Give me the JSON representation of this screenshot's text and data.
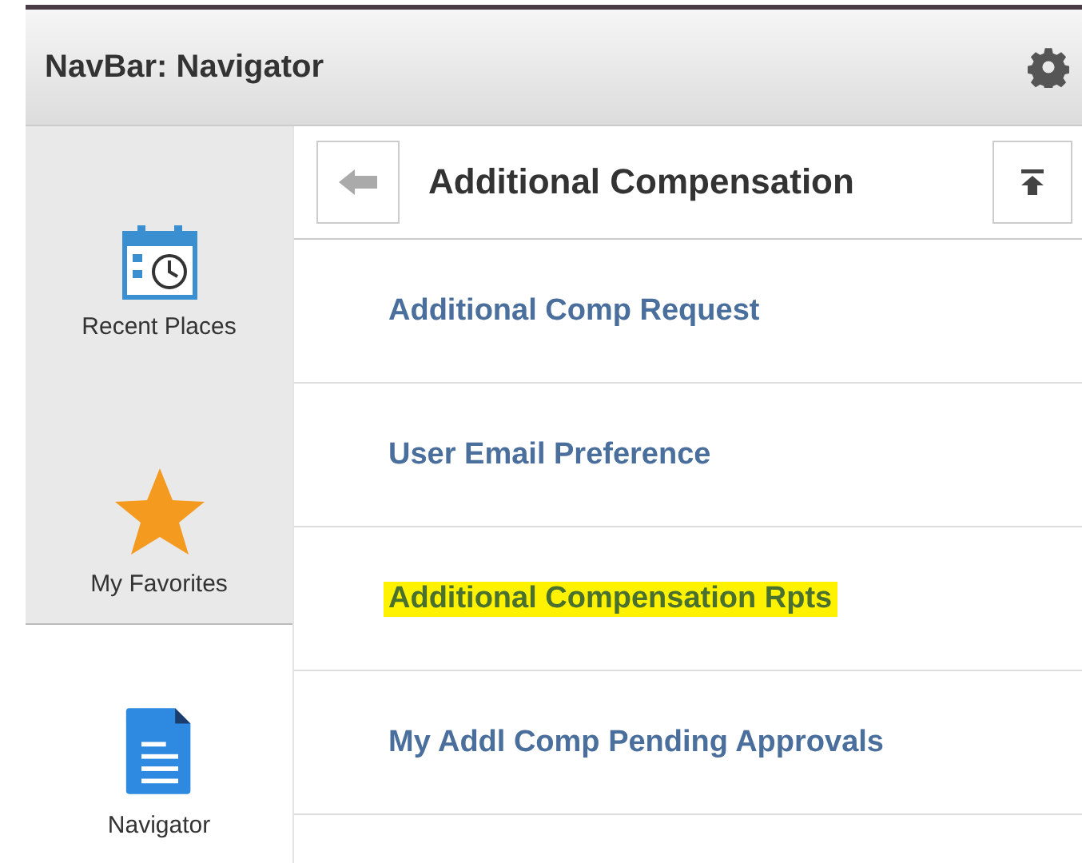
{
  "header": {
    "title": "NavBar: Navigator"
  },
  "sidebar": {
    "items": [
      {
        "label": "Recent Places",
        "kind": "calendar",
        "selected": false
      },
      {
        "label": "My Favorites",
        "kind": "star",
        "selected": false
      },
      {
        "label": "Navigator",
        "kind": "document",
        "selected": true
      }
    ]
  },
  "panel": {
    "title": "Additional Compensation",
    "items": [
      {
        "label": "Additional Comp Request",
        "highlighted": false
      },
      {
        "label": "User Email Preference",
        "highlighted": false
      },
      {
        "label": "Additional Compensation Rpts",
        "highlighted": true
      },
      {
        "label": "My Addl Comp Pending Approvals",
        "highlighted": false
      }
    ]
  }
}
